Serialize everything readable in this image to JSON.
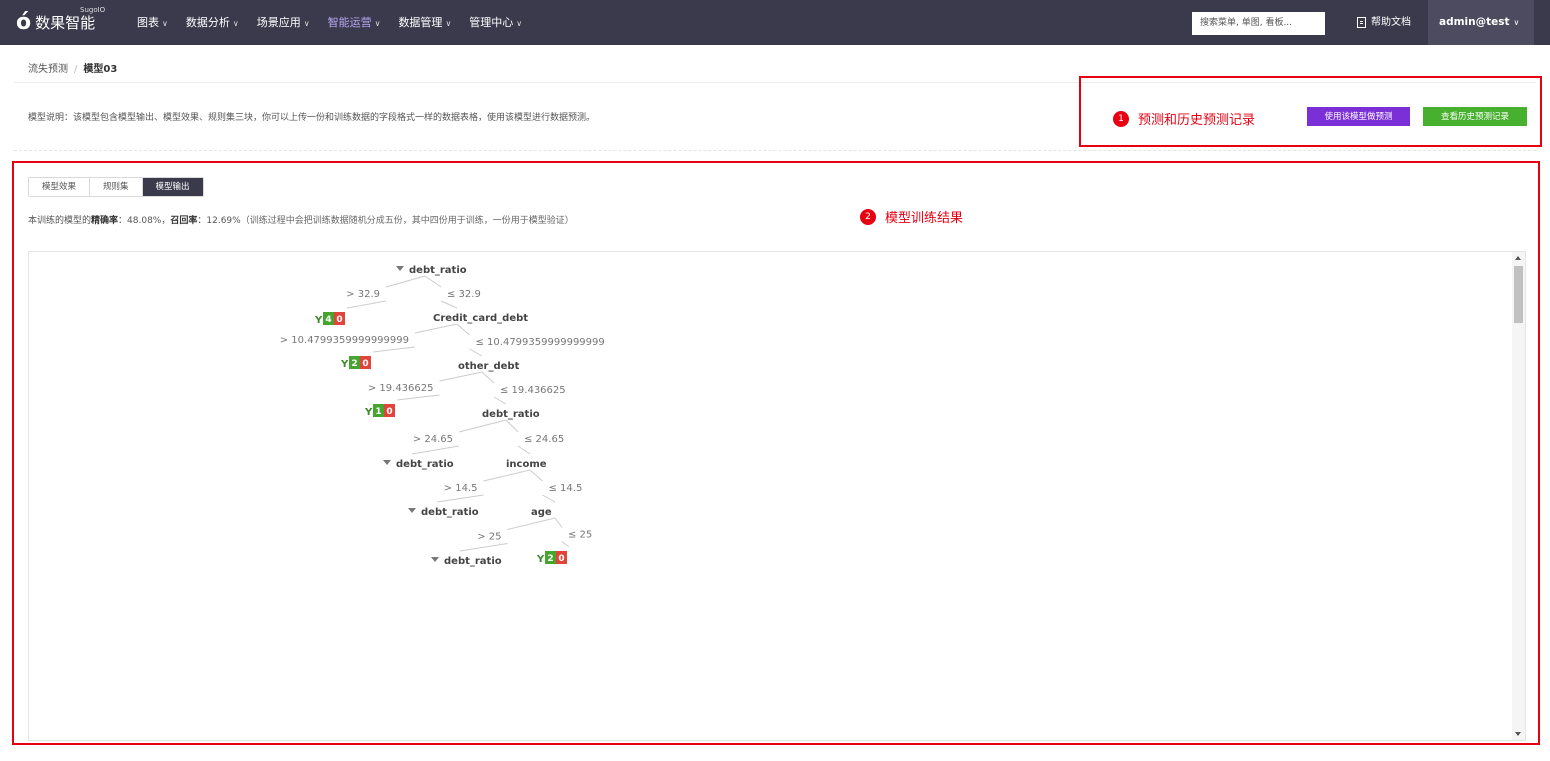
{
  "app": {
    "logo_text": "数果智能",
    "logo_sup": "SugoIO"
  },
  "nav": {
    "items": [
      {
        "label": "图表",
        "active": false
      },
      {
        "label": "数据分析",
        "active": false
      },
      {
        "label": "场景应用",
        "active": false
      },
      {
        "label": "智能运营",
        "active": true
      },
      {
        "label": "数据管理",
        "active": false
      },
      {
        "label": "管理中心",
        "active": false
      }
    ],
    "search_placeholder": "搜索菜单, 单图, 看板...",
    "help_label": "帮助文档",
    "user_label": "admin@test"
  },
  "breadcrumb": {
    "parent": "流失预测",
    "separator": "/",
    "current": "模型03"
  },
  "description": "模型说明：该模型包含模型输出、模型效果、规则集三块，你可以上传一份和训练数据的字段格式一样的数据表格，使用该模型进行数据预测。",
  "annotations": {
    "a1_num": "1",
    "a1_text": "预测和历史预测记录",
    "a2_num": "2",
    "a2_text": "模型训练结果"
  },
  "buttons": {
    "predict": "使用该模型做预测",
    "history": "查看历史预测记录"
  },
  "tabs": [
    {
      "label": "模型效果",
      "active": false
    },
    {
      "label": "规则集",
      "active": false
    },
    {
      "label": "模型输出",
      "active": true
    }
  ],
  "stats": {
    "prefix": "本训练的模型的",
    "precision_label": "精确率",
    "precision_value": "：48.08%，",
    "recall_label": "召回率",
    "recall_value": "：12.69%",
    "note": "（训练过程中会把训练数据随机分成五份，其中四份用于训练，一份用于模型验证）"
  },
  "tree": {
    "nodes": [
      {
        "id": "n1",
        "label": "debt_ratio",
        "collapsible": true
      },
      {
        "id": "n2",
        "label": "Credit_card_debt",
        "collapsible": false
      },
      {
        "id": "n3",
        "label": "other_debt",
        "collapsible": false
      },
      {
        "id": "n4",
        "label": "debt_ratio",
        "collapsible": false
      },
      {
        "id": "n5",
        "label": "debt_ratio",
        "collapsible": true
      },
      {
        "id": "n6",
        "label": "income",
        "collapsible": false
      },
      {
        "id": "n7",
        "label": "debt_ratio",
        "collapsible": true
      },
      {
        "id": "n8",
        "label": "age",
        "collapsible": false
      },
      {
        "id": "n9",
        "label": "debt_ratio",
        "collapsible": true
      }
    ],
    "edges": [
      {
        "from": "n1",
        "to": "l1",
        "label": "> 32.9"
      },
      {
        "from": "n1",
        "to": "n2",
        "label": "≤ 32.9"
      },
      {
        "from": "n2",
        "to": "l2",
        "label": "> 10.4799359999999999"
      },
      {
        "from": "n2",
        "to": "n3",
        "label": "≤ 10.4799359999999999"
      },
      {
        "from": "n3",
        "to": "l3",
        "label": "> 19.436625"
      },
      {
        "from": "n3",
        "to": "n4",
        "label": "≤ 19.436625"
      },
      {
        "from": "n4",
        "to": "n5",
        "label": "> 24.65"
      },
      {
        "from": "n4",
        "to": "n6",
        "label": "≤ 24.65"
      },
      {
        "from": "n6",
        "to": "n7",
        "label": "> 14.5"
      },
      {
        "from": "n6",
        "to": "n8",
        "label": "≤ 14.5"
      },
      {
        "from": "n8",
        "to": "n9",
        "label": "> 25"
      },
      {
        "from": "n8",
        "to": "l4",
        "label": "≤ 25"
      }
    ],
    "leaves": [
      {
        "id": "l1",
        "class": "Y",
        "yes": "4",
        "no": "0"
      },
      {
        "id": "l2",
        "class": "Y",
        "yes": "2",
        "no": "0"
      },
      {
        "id": "l3",
        "class": "Y",
        "yes": "1",
        "no": "0"
      },
      {
        "id": "l4",
        "class": "Y",
        "yes": "2",
        "no": "0"
      }
    ]
  },
  "colors": {
    "nav_bg": "#3b3a4c",
    "nav_active": "#b7a7f4",
    "annotation_red": "#e60012",
    "btn_purple": "#7b2fd6",
    "btn_green": "#47b02f",
    "leaf_yes": "#47a52f",
    "leaf_no": "#e0443a"
  }
}
